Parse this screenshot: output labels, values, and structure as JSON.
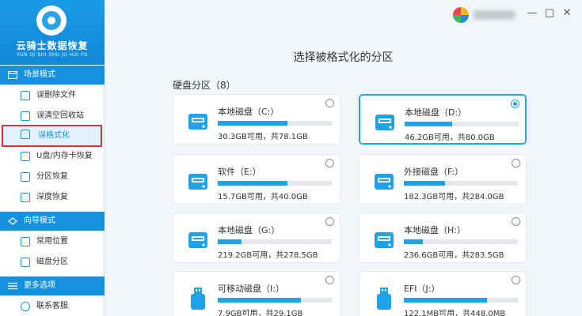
{
  "app": {
    "name": "云骑士数据恢复",
    "name_en": "YUN QI SHI SHU JU HUI FU"
  },
  "sidebar": {
    "sections": [
      {
        "label": "场景模式",
        "icon": "scene-mode-icon"
      },
      {
        "label": "向导模式",
        "icon": "guide-mode-icon"
      },
      {
        "label": "更多选项",
        "icon": "more-options-icon"
      }
    ],
    "items": [
      {
        "label": "误删除文件",
        "icon": "deleted-file-icon"
      },
      {
        "label": "误清空回收站",
        "icon": "recycle-bin-icon"
      },
      {
        "label": "误格式化",
        "icon": "format-icon",
        "active": true
      },
      {
        "label": "U盘/内存卡恢复",
        "icon": "usb-icon"
      },
      {
        "label": "分区恢复",
        "icon": "partition-icon"
      },
      {
        "label": "深度恢复",
        "icon": "deep-scan-icon"
      },
      {
        "label": "常用位置",
        "icon": "common-location-icon"
      },
      {
        "label": "磁盘分区",
        "icon": "disk-partition-icon"
      },
      {
        "label": "联系客服",
        "icon": "customer-service-icon"
      }
    ]
  },
  "window_controls": {
    "minimize": "—",
    "restore": "□",
    "close": "✕"
  },
  "main": {
    "title": "选择被格式化的分区",
    "disk_section_label": "硬盘分区（8）",
    "partitions": [
      {
        "name": "本地磁盘（C:）",
        "info": "30.3GB可用，共78.1GB",
        "used_fraction": 0.61,
        "selected": false,
        "kind": "hdd"
      },
      {
        "name": "本地磁盘（D:）",
        "info": "46.2GB可用，共80.0GB",
        "used_fraction": 0.42,
        "selected": true,
        "kind": "hdd"
      },
      {
        "name": "软件（E:）",
        "info": "15.7GB可用，共40.0GB",
        "used_fraction": 0.61,
        "selected": false,
        "kind": "hdd"
      },
      {
        "name": "外接磁盘（F:）",
        "info": "182.3GB可用，共284.0GB",
        "used_fraction": 0.36,
        "selected": false,
        "kind": "hdd"
      },
      {
        "name": "本地磁盘（G:）",
        "info": "219.2GB可用，共278.5GB",
        "used_fraction": 0.21,
        "selected": false,
        "kind": "hdd"
      },
      {
        "name": "本地磁盘（H:）",
        "info": "236.6GB可用，共283.5GB",
        "used_fraction": 0.17,
        "selected": false,
        "kind": "hdd"
      },
      {
        "name": "可移动磁盘（I:）",
        "info": "7.9GB可用，共29.1GB",
        "used_fraction": 0.73,
        "selected": false,
        "kind": "usb"
      },
      {
        "name": "EFI（J:）",
        "info": "122.1MB可用，共448.0MB",
        "used_fraction": 0.73,
        "selected": false,
        "kind": "usb"
      }
    ]
  },
  "colors": {
    "accent": "#1592df",
    "bar_fill": "#1ea3e8",
    "active_outline": "#d9343b",
    "selected_border": "#26a6e6"
  }
}
